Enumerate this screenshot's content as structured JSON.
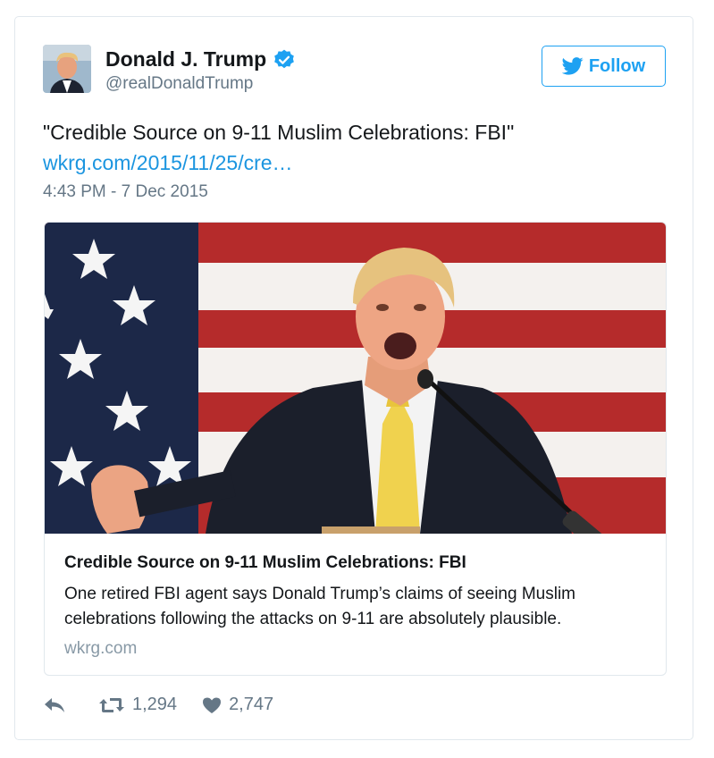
{
  "user": {
    "name": "Donald J. Trump",
    "handle": "@realDonaldTrump",
    "verified_icon": "verified-badge-icon"
  },
  "follow": {
    "label": "Follow",
    "icon": "twitter-bird-icon"
  },
  "tweet": {
    "text": "\"Credible Source on 9-11 Muslim Celebrations: FBI\"",
    "link": "wkrg.com/2015/11/25/cre…",
    "timestamp": "4:43 PM - 7 Dec 2015"
  },
  "card": {
    "image": "photo-trump-speaking-flag",
    "title": "Credible Source on 9-11 Muslim Celebrations: FBI",
    "description": "One retired FBI agent says Donald Trump’s claims of seeing Muslim celebrations following the attacks on 9-11 are absolutely plausible.",
    "domain": "wkrg.com"
  },
  "actions": {
    "reply_icon": "reply-icon",
    "retweet_icon": "retweet-icon",
    "retweets": "1,294",
    "like_icon": "heart-icon",
    "likes": "2,747"
  },
  "colors": {
    "accent": "#1da1f2",
    "link": "#1b95e0",
    "muted": "#657786",
    "border": "#e1e8ed"
  }
}
